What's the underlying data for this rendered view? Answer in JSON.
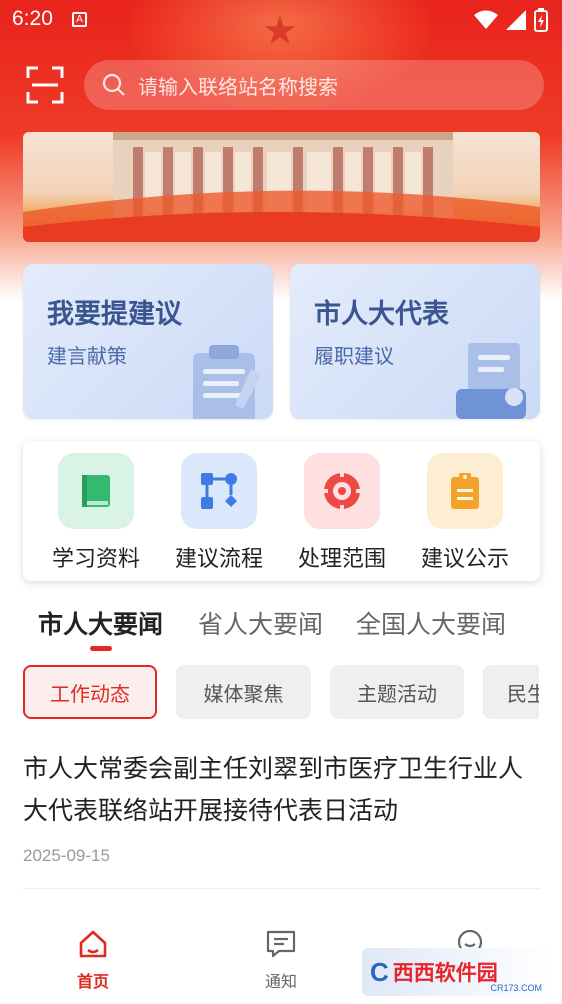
{
  "status_bar": {
    "time": "6:20",
    "notification_glyph": "A"
  },
  "search": {
    "placeholder": "请输入联络站名称搜索"
  },
  "feature_cards": [
    {
      "title": "我要提建议",
      "subtitle": "建言献策"
    },
    {
      "title": "市人大代表",
      "subtitle": "履职建议"
    }
  ],
  "quick_menu": [
    {
      "label": "学习资料",
      "icon": "book-icon",
      "color": "#34b96e",
      "bg": "#d9f3e4"
    },
    {
      "label": "建议流程",
      "icon": "flowchart-icon",
      "color": "#3f7be6",
      "bg": "#dbe8fc"
    },
    {
      "label": "处理范围",
      "icon": "target-icon",
      "color": "#ee4a45",
      "bg": "#fde0df"
    },
    {
      "label": "建议公示",
      "icon": "clipboard-icon",
      "color": "#f4a32a",
      "bg": "#fdedd3"
    }
  ],
  "news_tabs": [
    "市人大要闻",
    "省人大要闻",
    "全国人大要闻"
  ],
  "chips": [
    "工作动态",
    "媒体聚焦",
    "主题活动",
    "民生"
  ],
  "article": {
    "title": "市人大常委会副主任刘翠到市医疗卫生行业人大代表联络站开展接待代表日活动",
    "date": "2025-09-15"
  },
  "bottom_nav": [
    "首页",
    "通知"
  ],
  "watermark": {
    "logo": "C",
    "text": "西西软件园",
    "sub": "CR173.COM"
  },
  "colors": {
    "brand_red": "#e02a20",
    "card_title": "#3b5590"
  }
}
